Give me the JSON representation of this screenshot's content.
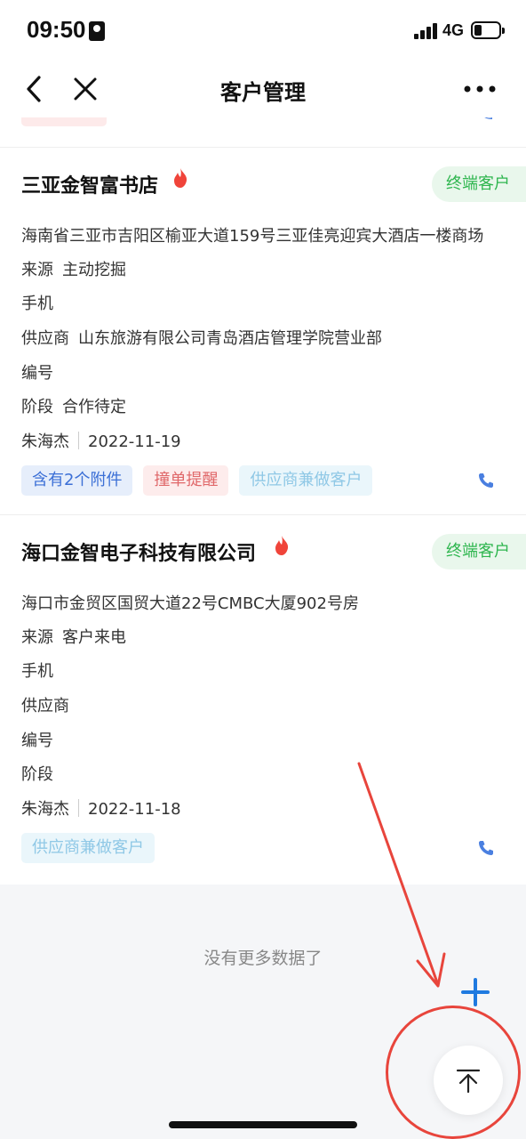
{
  "status_bar": {
    "time": "09:50",
    "network": "4G"
  },
  "nav": {
    "title": "客户管理",
    "back_icon": "chevron-left-icon",
    "close_icon": "close-icon",
    "more_icon": "more-dots-icon"
  },
  "customers": [
    {
      "name": "三亚金智富书店",
      "type_badge": "终端客户",
      "address": "海南省三亚市吉阳区榆亚大道159号三亚佳亮迎宾大酒店一楼商场",
      "source_label": "来源",
      "source": "主动挖掘",
      "phone_label": "手机",
      "phone": "",
      "supplier_label": "供应商",
      "supplier": "山东旅游有限公司青岛酒店管理学院营业部",
      "code_label": "编号",
      "code": "",
      "stage_label": "阶段",
      "stage": "合作待定",
      "owner": "朱海杰",
      "date": "2022-11-19",
      "tags": [
        "含有2个附件",
        "撞单提醒",
        "供应商兼做客户"
      ]
    },
    {
      "name": "海口金智电子科技有限公司",
      "type_badge": "终端客户",
      "address": "海口市金贸区国贸大道22号CMBC大厦902号房",
      "source_label": "来源",
      "source": "客户来电",
      "phone_label": "手机",
      "phone": "",
      "supplier_label": "供应商",
      "supplier": "",
      "code_label": "编号",
      "code": "",
      "stage_label": "阶段",
      "stage": "",
      "owner": "朱海杰",
      "date": "2022-11-18",
      "tags": [
        "供应商兼做客户"
      ]
    }
  ],
  "footer": {
    "no_more_text": "没有更多数据了",
    "add_icon": "plus-icon",
    "top_icon": "back-to-top-icon"
  },
  "colors": {
    "badge_green": "#2fb64f",
    "tag_blue": "#3b6fd6",
    "tag_red": "#e0686a",
    "tag_cyan": "#8fc8e6",
    "annotation_red": "#e8453c"
  }
}
